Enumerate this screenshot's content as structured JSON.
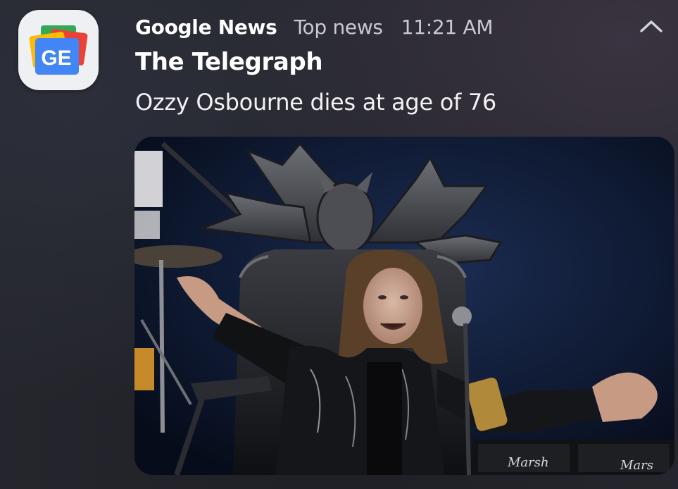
{
  "notification": {
    "app_name": "Google News",
    "channel": "Top news",
    "time": "11:21 AM",
    "source": "The Telegraph",
    "headline": "Ozzy Osbourne dies at age of 76"
  },
  "app_icon": {
    "name": "google-news-icon",
    "letters": "GE"
  },
  "collapse_icon": "chevron-up-icon",
  "colors": {
    "background": "#25262d",
    "primary_text": "#ffffff",
    "secondary_text": "#c9c9cf",
    "google_blue": "#4285f4",
    "google_red": "#ea4335",
    "google_yellow": "#fbbc04",
    "google_green": "#34a853"
  }
}
